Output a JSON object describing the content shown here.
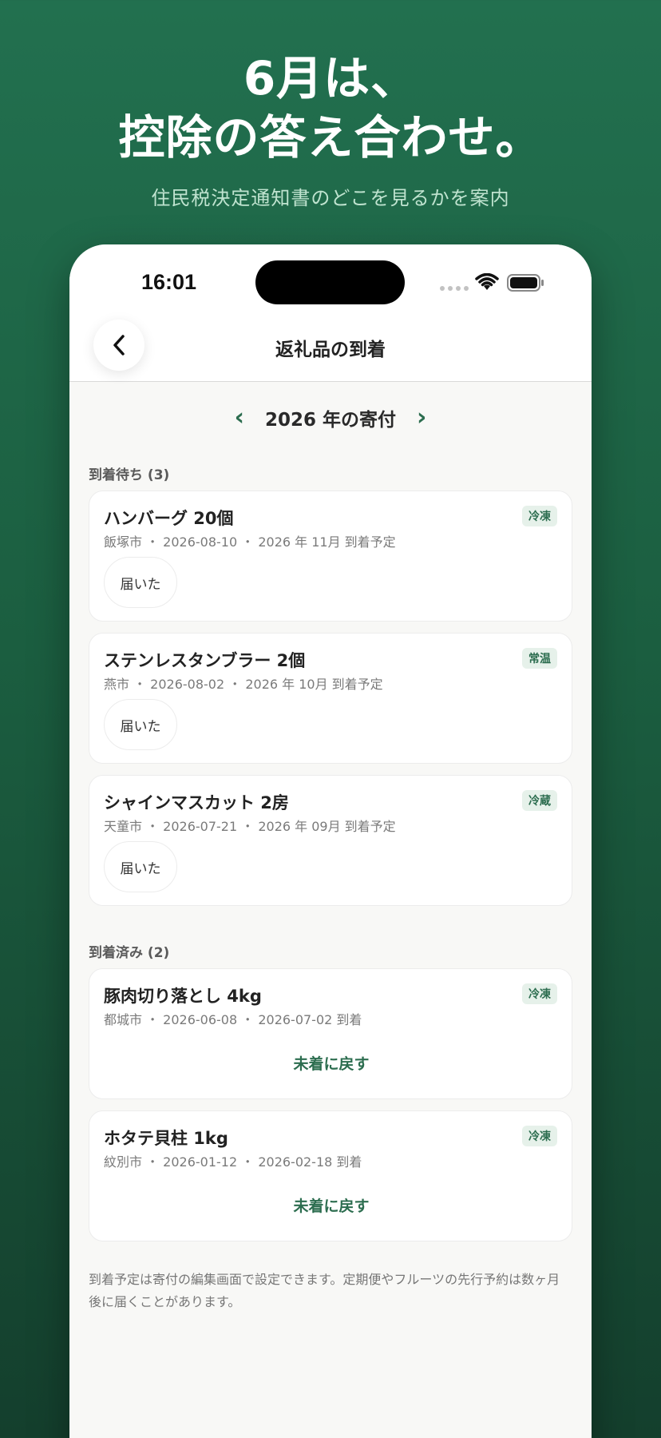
{
  "hero": {
    "line1": "6月は、",
    "line2": "控除の答え合わせ。",
    "subtitle": "住民税決定通知書のどこを見るかを案内"
  },
  "status_bar": {
    "time": "16:01",
    "icons": [
      "signal-icon",
      "wifi-icon",
      "battery-icon"
    ]
  },
  "header": {
    "title": "返礼品の到着",
    "back_icon": "chevron-left-icon"
  },
  "year_nav": {
    "prev": "‹",
    "label": "2026 年の寄付",
    "next": "›"
  },
  "pending": {
    "title": "到着待ち (3)",
    "items": [
      {
        "name": "ハンバーグ 20個",
        "meta": "飯塚市 ・ 2026-08-10 ・ 2026 年 11月 到着予定",
        "badge": "冷凍",
        "action": "届いた"
      },
      {
        "name": "ステンレスタンブラー 2個",
        "meta": "燕市 ・ 2026-08-02 ・ 2026 年 10月 到着予定",
        "badge": "常温",
        "action": "届いた"
      },
      {
        "name": "シャインマスカット 2房",
        "meta": "天童市 ・ 2026-07-21 ・ 2026 年 09月 到着予定",
        "badge": "冷蔵",
        "action": "届いた"
      }
    ]
  },
  "arrived": {
    "title": "到着済み (2)",
    "items": [
      {
        "name": "豚肉切り落とし 4kg",
        "meta": "都城市 ・ 2026-06-08 ・ 2026-07-02 到着",
        "badge": "冷凍",
        "action": "未着に戻す"
      },
      {
        "name": "ホタテ貝柱 1kg",
        "meta": "紋別市 ・ 2026-01-12 ・ 2026-02-18 到着",
        "badge": "冷凍",
        "action": "未着に戻す"
      }
    ]
  },
  "footnote": "到着予定は寄付の編集画面で設定できます。定期便やフルーツの先行予約は数ヶ月後に届くことがあります。",
  "colors": {
    "accent": "#2c6d4f",
    "background_top": "#22704f",
    "background_bottom": "#143f2d",
    "badge_bg": "#e6f1ea"
  }
}
